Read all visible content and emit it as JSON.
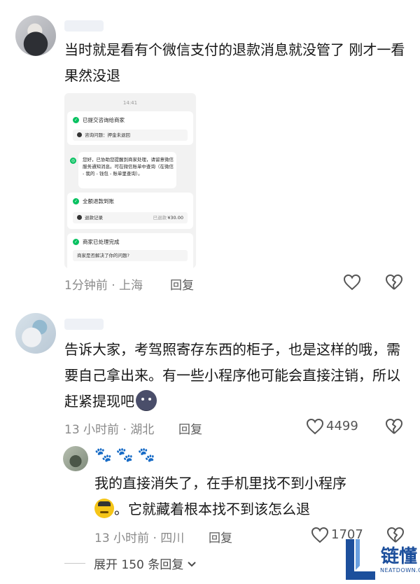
{
  "comments": [
    {
      "text": "当时就是看有个微信支付的退款消息就没管了 刚才一看果然没退",
      "meta": "1分钟前 · 上海",
      "reply_label": "回复"
    },
    {
      "text": "告诉大家，考驾照寄存东西的柜子，也是这样的哦，需要自己拿出来。有一些小程序他可能会直接注销，所以赶紧提现吧",
      "meta": "13 小时前 · 湖北",
      "reply_label": "回复",
      "like_count": "4499"
    },
    {
      "name": "🐾🐾🐾",
      "text_part1": "我的直接消失了，在手机里找不到小程序",
      "text_part2": "。它就藏着根本找不到该怎么退",
      "meta": "13 小时前 · 四川",
      "reply_label": "回复",
      "like_count": "1707"
    }
  ],
  "expand_replies": "展开 150 条回复",
  "screenshot": {
    "time": "14:41",
    "step1_title": "已提交咨询给商家",
    "step1_pill": "咨询问题：押金未退回",
    "bot_msg": "您好，已协助您提醒到商家处理，请留意微信服务通知消息。可在微信账单中查询（在微信 - 我的 - 钱包 - 账单里查询）。",
    "step2_title": "全额退款到账",
    "step2_pill_left": "退款记录",
    "step2_pill_status": "已退款",
    "step2_pill_amount": "¥30.00",
    "step3_title": "商家已处理完成",
    "step3_pill": "商家是否解决了你的问题?"
  },
  "watermark": {
    "brand": "链懂",
    "domain": "NEATDOWN.COM"
  },
  "icons": [
    "heart-icon",
    "broken-heart-icon",
    "chevron-down-icon",
    "emoji-icon"
  ]
}
